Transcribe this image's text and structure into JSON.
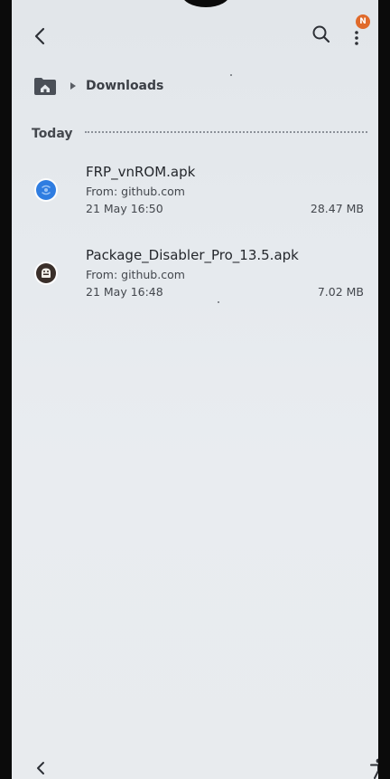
{
  "header": {
    "badge": "N",
    "back_icon": "chevron-left-icon",
    "search_icon": "search-icon",
    "menu_icon": "more-vertical-icon"
  },
  "breadcrumb": {
    "home_icon": "home-folder-icon",
    "current": "Downloads"
  },
  "section": {
    "title": "Today"
  },
  "files": [
    {
      "name": "FRP_vnROM.apk",
      "source": "From: github.com",
      "date": "21 May 16:50",
      "size": "28.47 MB",
      "icon": "app-globe-icon",
      "icon_color": "#2f7de1"
    },
    {
      "name": "Package_Disabler_Pro_13.5.apk",
      "source": "From: github.com",
      "date": "21 May 16:48",
      "size": "7.02 MB",
      "icon": "android-app-icon",
      "icon_color": "#3a2f2a"
    }
  ],
  "nav": {
    "back_icon": "nav-back-icon",
    "accessibility_icon": "accessibility-icon"
  },
  "colors": {
    "background": "#e6eaee",
    "badge": "#e06a2b",
    "text_primary": "#24272c",
    "text_secondary": "#43474d"
  }
}
